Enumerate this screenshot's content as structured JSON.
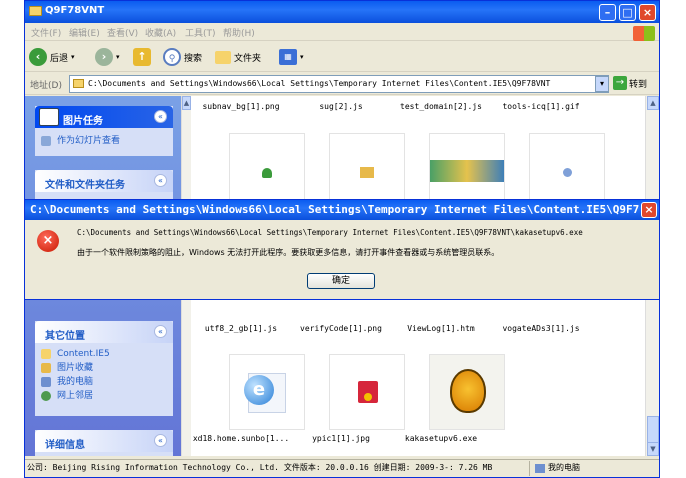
{
  "window": {
    "title": "Q9F78VNT",
    "menu": [
      "文件(F)",
      "编辑(E)",
      "查看(V)",
      "收藏(A)",
      "工具(T)",
      "帮助(H)"
    ],
    "toolbar": {
      "back": "后退",
      "search": "搜索",
      "folders": "文件夹"
    },
    "address_label": "地址(D)",
    "address": "C:\\Documents and Settings\\Windows66\\Local Settings\\Temporary Internet Files\\Content.IE5\\Q9F78VNT",
    "go": "转到"
  },
  "sidebar": {
    "picture_tasks": {
      "title": "图片任务",
      "items": [
        "作为幻灯片查看"
      ]
    },
    "file_tasks": {
      "title": "文件和文件夹任务"
    },
    "other_places": {
      "title": "其它位置",
      "items": [
        "Content.IE5",
        "图片收藏",
        "我的电脑",
        "网上邻居"
      ]
    },
    "details": {
      "title": "详细信息"
    }
  },
  "files": {
    "row1": [
      "subnav_bg[1].png",
      "sug[2].js",
      "test_domain[2].js",
      "tools-icq[1].gif"
    ],
    "row3": [
      "utf8_2_gb[1].js",
      "verifyCode[1].png",
      "ViewLog[1].htm",
      "vogateADs3[1].js"
    ],
    "row4": [
      "xd18.home.sunbo[1...",
      "ypic1[1].jpg",
      "kakasetupv6.exe"
    ]
  },
  "status": {
    "text": "公司: Beijing Rising Information Technology Co., Ltd. 文件版本: 20.0.0.16 创建日期: 2009-3-: 7.26 MB",
    "computer": "我的电脑"
  },
  "dialog": {
    "title": "C:\\Documents and Settings\\Windows66\\Local Settings\\Temporary Internet Files\\Content.IE5\\Q9F7...",
    "path": "C:\\Documents and Settings\\Windows66\\Local Settings\\Temporary Internet Files\\Content.IE5\\Q9F78VNT\\kakasetupv6.exe",
    "message": "由于一个软件限制策略的阻止，Windows 无法打开此程序。要获取更多信息，请打开事件查看器或与系统管理员联系。",
    "ok": "确定"
  }
}
